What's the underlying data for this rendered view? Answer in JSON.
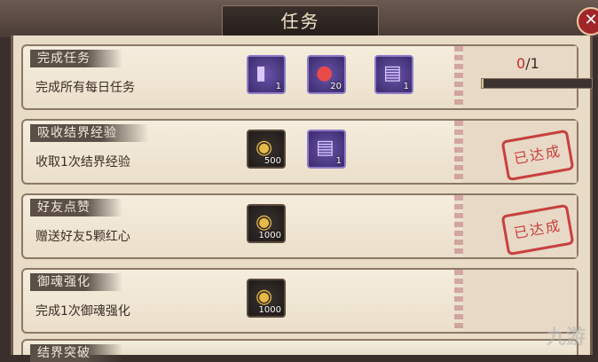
{
  "window": {
    "title": "任务",
    "close_label": "✕"
  },
  "tasks": [
    {
      "title": "完成任务",
      "desc": "完成所有每日任务",
      "rewards": [
        {
          "icon": "purple-talisman-icon",
          "qty": "1",
          "style": "purple"
        },
        {
          "icon": "red-daruma-icon",
          "qty": "20",
          "style": "purple"
        },
        {
          "icon": "summon-scroll-icon",
          "qty": "1",
          "style": "purple"
        }
      ],
      "status": {
        "type": "progress",
        "current": "0",
        "total": "/1",
        "fraction": 0.02
      }
    },
    {
      "title": "吸收结界经验",
      "desc": "收取1次结界经验",
      "rewards": [
        {
          "icon": "gold-coin-icon",
          "qty": "500",
          "style": "dark"
        },
        {
          "icon": "summon-scroll-icon",
          "qty": "1",
          "style": "purple"
        }
      ],
      "status": {
        "type": "stamp",
        "label": "已达成"
      }
    },
    {
      "title": "好友点赞",
      "desc": "赠送好友5颗红心",
      "rewards": [
        {
          "icon": "gold-coin-icon",
          "qty": "1000",
          "style": "dark"
        }
      ],
      "status": {
        "type": "stamp",
        "label": "已达成"
      }
    },
    {
      "title": "御魂强化",
      "desc": "完成1次御魂强化",
      "rewards": [
        {
          "icon": "gold-coin-icon",
          "qty": "1000",
          "style": "dark"
        }
      ],
      "status": {
        "type": "none"
      }
    },
    {
      "title": "结界突破",
      "desc": "",
      "rewards": [],
      "status": {
        "type": "none"
      }
    }
  ],
  "watermark": "九游"
}
